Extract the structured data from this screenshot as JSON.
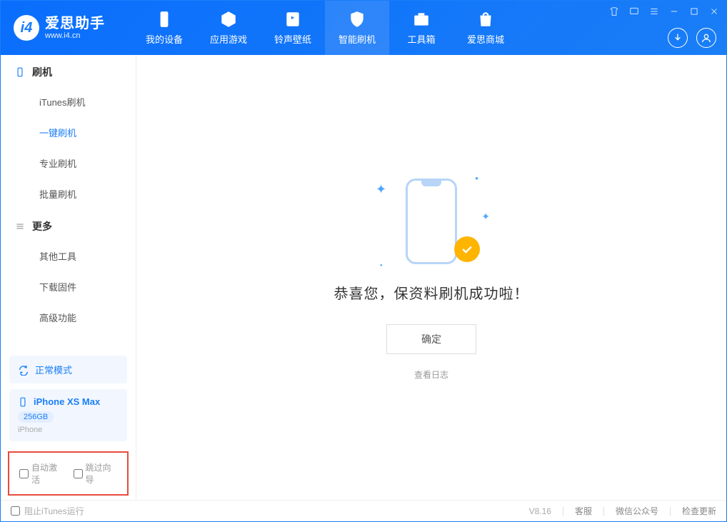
{
  "app": {
    "title": "爱思助手",
    "subtitle": "www.i4.cn"
  },
  "header_tabs": [
    {
      "label": "我的设备"
    },
    {
      "label": "应用游戏"
    },
    {
      "label": "铃声壁纸"
    },
    {
      "label": "智能刷机"
    },
    {
      "label": "工具箱"
    },
    {
      "label": "爱思商城"
    }
  ],
  "sidebar": {
    "group1_title": "刷机",
    "group1_items": [
      {
        "label": "iTunes刷机"
      },
      {
        "label": "一键刷机"
      },
      {
        "label": "专业刷机"
      },
      {
        "label": "批量刷机"
      }
    ],
    "group2_title": "更多",
    "group2_items": [
      {
        "label": "其他工具"
      },
      {
        "label": "下载固件"
      },
      {
        "label": "高级功能"
      }
    ],
    "mode": "正常模式",
    "device_name": "iPhone XS Max",
    "device_storage": "256GB",
    "device_type": "iPhone",
    "checkbox1": "自动激活",
    "checkbox2": "跳过向导"
  },
  "main": {
    "success_text": "恭喜您，保资料刷机成功啦！",
    "ok_button": "确定",
    "view_log": "查看日志"
  },
  "footer": {
    "block_itunes": "阻止iTunes运行",
    "version": "V8.16",
    "service": "客服",
    "wechat": "微信公众号",
    "check_update": "检查更新"
  }
}
